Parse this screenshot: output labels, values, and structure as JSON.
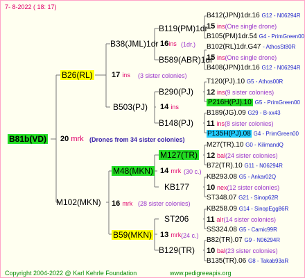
{
  "header": {
    "date": "7-  8-2022 ( 18: 17)"
  },
  "footer": {
    "copyright": "Copyright 2004-2022 @ Karl Kehrle Foundation",
    "url": "www.pedigreeapis.org"
  },
  "root": {
    "name": "B81b(VD)",
    "count": "20",
    "unit": "mrk",
    "note": "(Drones from 34 sister colonies)"
  },
  "gen1": [
    {
      "name": "B26(RL)",
      "count": "17",
      "unit": "ins",
      "note": "(3 sister colonies)"
    },
    {
      "name": "M102(MKN)",
      "count": "16",
      "unit": "mrk",
      "note": "(28 sister colonies)"
    }
  ],
  "gen2": [
    {
      "name": "B38(JML)1dr",
      "count": "16",
      "unit": "ins",
      "note": "(1dr.)"
    },
    {
      "name": "B503(PJ)",
      "count": "14",
      "unit": "ins",
      "note": ""
    },
    {
      "name": "M48(MKN)",
      "count": "14",
      "unit": "mrk",
      "note": "(30 c.)"
    },
    {
      "name": "B59(MKN)",
      "count": "13",
      "unit": "mrk",
      "note": "(24 c.)"
    }
  ],
  "gen3": [
    {
      "name": "B119(PM)1dr"
    },
    {
      "name": "B589(ABR)1dr"
    },
    {
      "name": "B290(PJ)"
    },
    {
      "name": "B148(PJ)"
    },
    {
      "name": "M127(TR)"
    },
    {
      "name": "KB177"
    },
    {
      "name": "ST206"
    },
    {
      "name": "B129(TR)"
    }
  ],
  "gen4": [
    {
      "top": "B412(JPN)1dr.16",
      "top_src": "G12 - N06294R",
      "count": "15",
      "unit": "ins",
      "note": "(One single drone)",
      "bottom": "B105(PM)1dr.54",
      "bottom_src": "G4 - PrimGreen00"
    },
    {
      "top": "B102(RL)1dr.G47",
      "top_src": "- AthosSt80R",
      "count": "15",
      "unit": "ins",
      "note": "(One single drone)",
      "bottom": "B408(JPN)1dr.16",
      "bottom_src": "G12 - N06294R"
    },
    {
      "top": "T120(PJ).10",
      "top_src": "G5 - Athos00R",
      "count": "12",
      "unit": "ins",
      "note": "(9 sister colonies)",
      "bottom": "P216H(PJ).10",
      "bottom_src": "G5 - PrimGreen00"
    },
    {
      "top": "B189(JG).09",
      "top_src": "G29 - B-xx43",
      "count": "11",
      "unit": "ins",
      "note": "(8 sister colonies)",
      "bottom": "P135H(PJ).08",
      "bottom_src": "G4 - PrimGreen00"
    },
    {
      "top": "M27(TR).10",
      "top_src": "G0 - KilimandQ",
      "count": "12",
      "unit": "bal",
      "note": "(24 sister colonies)",
      "bottom": "B72(TR).10",
      "bottom_src": "G11 - N06294R"
    },
    {
      "top": "KB293.08",
      "top_src": "G5 - Ankar02Q",
      "count": "10",
      "unit": "nex",
      "note": "(12 sister colonies)",
      "bottom": "ST348.07",
      "bottom_src": "G21 - Sinop62R"
    },
    {
      "top": "KB258.09",
      "top_src": "G14 - SinopEgg86R",
      "count": "11",
      "unit": "alr",
      "note": "(14 sister colonies)",
      "bottom": "SS324.08",
      "bottom_src": "G5 - Camic99R"
    },
    {
      "top": "B82(TR).07",
      "top_src": "G9 - N06294R",
      "count": "10",
      "unit": "bal",
      "note": "(23 sister colonies)",
      "bottom": "B135(TR).06",
      "bottom_src": "G8 - Takab93aR"
    }
  ]
}
